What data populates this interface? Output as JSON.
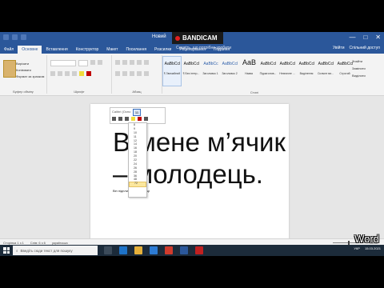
{
  "titlebar": {
    "doc_title": "Новий",
    "recorder_label": "BANDICAM",
    "recorder_extra": "",
    "window_buttons": [
      "—",
      "□",
      "✕"
    ]
  },
  "tabs": {
    "items": [
      {
        "label": "Файл",
        "active": false
      },
      {
        "label": "Основне",
        "active": true
      },
      {
        "label": "Вставлення",
        "active": false
      },
      {
        "label": "Конструктор",
        "active": false
      },
      {
        "label": "Макет",
        "active": false
      },
      {
        "label": "Посилання",
        "active": false
      },
      {
        "label": "Розсилки",
        "active": false
      },
      {
        "label": "Рецензування",
        "active": false
      },
      {
        "label": "Подання",
        "active": false
      }
    ],
    "tell_me": "Скажіть, що потрібно зробити",
    "account": "Увійти",
    "share": "Спільний доступ"
  },
  "ribbon": {
    "clipboard": {
      "items": [
        "Вирізати",
        "Копіювати",
        "Формат за зразком"
      ],
      "label": "Буфер обміну"
    },
    "font_label": "Шрифт",
    "paragraph_label": "Абзац",
    "styles": [
      {
        "sample": "AaBbCcI",
        "name": "¶ Звичайний",
        "variant": "normal",
        "selected": true
      },
      {
        "sample": "AaBbCcI",
        "name": "¶ Без інтер...",
        "variant": "normal",
        "selected": false
      },
      {
        "sample": "AaBbCc",
        "name": "Заголовок 1",
        "variant": "blue",
        "selected": false
      },
      {
        "sample": "AaBbCcI",
        "name": "Заголовок 2",
        "variant": "blue",
        "selected": false
      },
      {
        "sample": "AaB",
        "name": "Назва",
        "variant": "big",
        "selected": false
      },
      {
        "sample": "AaBbCcI",
        "name": "Підзаголов...",
        "variant": "normal",
        "selected": false
      },
      {
        "sample": "AaBbCcI",
        "name": "Незначне ...",
        "variant": "normal",
        "selected": false
      },
      {
        "sample": "AaBbCcI",
        "name": "Виділення",
        "variant": "normal",
        "selected": false
      },
      {
        "sample": "AaBbCcI",
        "name": "Сильне ви...",
        "variant": "normal",
        "selected": false
      },
      {
        "sample": "AaBbCcI",
        "name": "Строгий",
        "variant": "normal",
        "selected": false
      },
      {
        "sample": "AaBbCcI",
        "name": "Цитата",
        "variant": "normal",
        "selected": false
      }
    ],
    "styles_label": "Стилі",
    "editing": {
      "items": [
        "Знайти",
        "Замінити",
        "Виділити"
      ],
      "label": "Редагування"
    }
  },
  "mini_toolbar": {
    "font_name": "Calibri (Осно",
    "font_size": "11"
  },
  "font_size_list": [
    "8",
    "9",
    "10",
    "11",
    "12",
    "14",
    "16",
    "18",
    "20",
    "22",
    "24",
    "26",
    "28",
    "36",
    "48",
    "72"
  ],
  "font_size_selected_index": 15,
  "document": {
    "heading_line1": "В мене м’ячик",
    "heading_line2": "– молодець.",
    "small_line": "Він підпливає до криниці"
  },
  "statusbar": {
    "page": "Сторінка 1 з 1",
    "words": "Слів: 6 з 6",
    "lang": "українська",
    "zoom": "100%"
  },
  "taskbar": {
    "search_placeholder": "Введіть сюди текст для пошуку",
    "time": "",
    "date": "15.03.2021",
    "lang": "УКР"
  },
  "watermark": "Word"
}
